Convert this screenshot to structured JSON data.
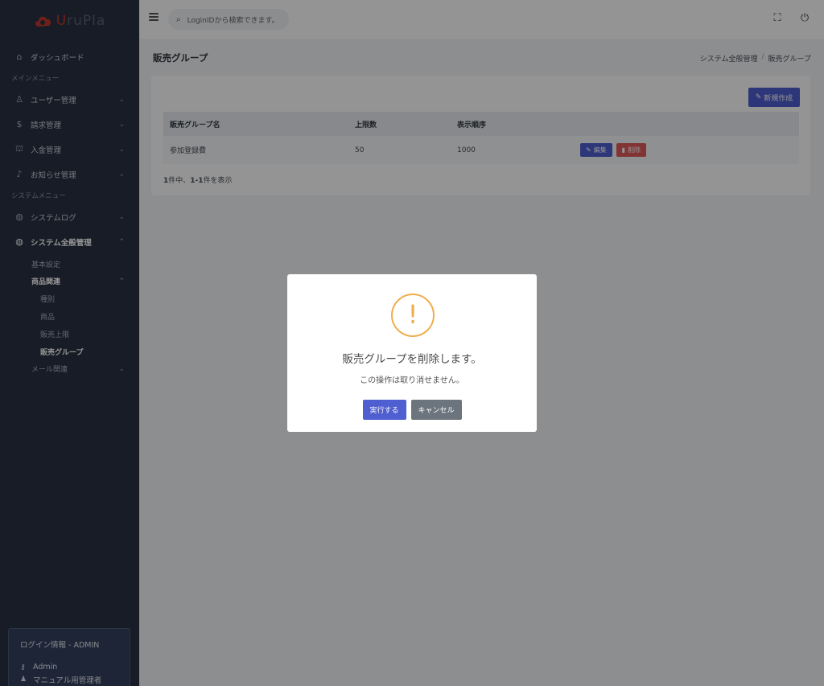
{
  "app": {
    "logo_prefix": "U",
    "logo_text": "ruPla"
  },
  "sidebar": {
    "dashboard": "ダッシュボード",
    "main_menu_title": "メインメニュー",
    "main_items": [
      {
        "label": "ユーザー管理",
        "icon": "user-icon"
      },
      {
        "label": "請求管理",
        "icon": "dollar-icon"
      },
      {
        "label": "入金管理",
        "icon": "bank-icon"
      },
      {
        "label": "お知らせ管理",
        "icon": "bell-icon"
      }
    ],
    "system_menu_title": "システムメニュー",
    "system_log": "システムログ",
    "system_general": "システム全般管理",
    "basic_settings": "基本設定",
    "product_related": "商品関連",
    "product_sub": [
      "種別",
      "商品",
      "販売上限",
      "販売グループ"
    ],
    "mail_related": "メール関連"
  },
  "login_info": {
    "title": "ログイン情報 - ADMIN",
    "user": "Admin",
    "role": "マニュアル用管理者"
  },
  "topbar": {
    "search_placeholder": "LoginIDから検索できます。"
  },
  "page": {
    "title": "販売グループ",
    "breadcrumb": [
      "システム全般管理",
      "/",
      "販売グループ"
    ],
    "new_button": "新規作成"
  },
  "table": {
    "headers": [
      "販売グループ名",
      "上限数",
      "表示順序"
    ],
    "rows": [
      {
        "name": "参加登録費",
        "limit": "50",
        "order": "1000",
        "edit": "編集",
        "delete": "削除"
      }
    ],
    "count_prefix": "1",
    "count_mid": "件中、",
    "count_range": "1-1",
    "count_suffix": "件を表示"
  },
  "modal": {
    "icon": "!",
    "title": "販売グループを削除します。",
    "text": "この操作は取り消せません。",
    "confirm": "実行する",
    "cancel": "キャンセル"
  },
  "colors": {
    "sidebar": "#2a3142",
    "primary": "#4f5ed0",
    "danger": "#e05a5a",
    "warning": "#f0ad4e",
    "secondary": "#6c757d"
  }
}
